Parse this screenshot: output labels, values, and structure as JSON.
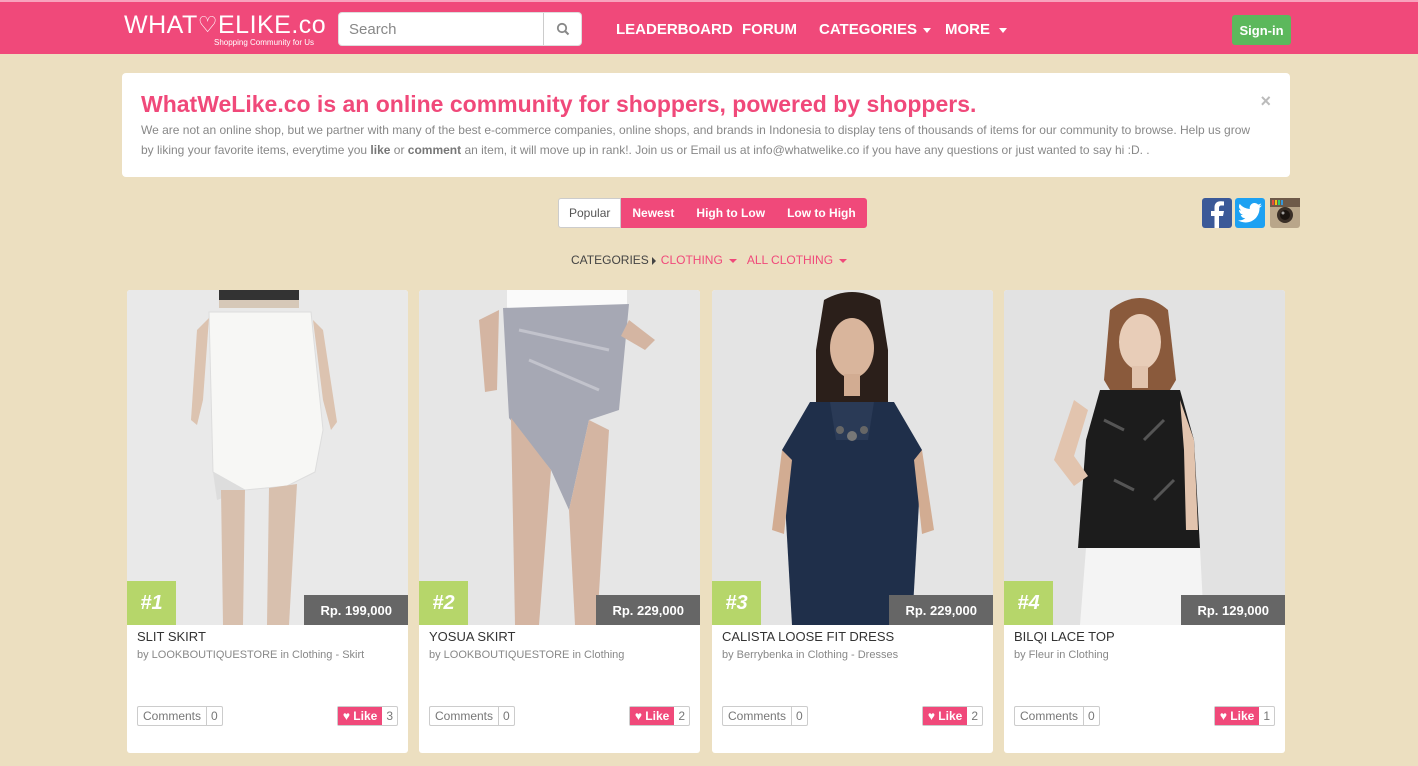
{
  "nav": {
    "logo_text": "WHATWELIKE.co",
    "logo_left": "WHAT",
    "logo_right": "ELIKE.co",
    "logo_tagline": "Shopping Community for Us",
    "search_placeholder": "Search",
    "links": [
      "LEADERBOARD",
      "FORUM",
      "CATEGORIES",
      "MORE"
    ],
    "signin_label": "Sign-in"
  },
  "banner": {
    "title": "WhatWeLike.co is an online community for shoppers, powered by shoppers.",
    "text_part1": "We are not an online shop, but we partner with many of the best e-commerce companies, online shops, and brands in Indonesia to display tens of thousands of items for our community to browse. Help us grow by liking your favorite items, everytime you ",
    "bold1": "like",
    "text_part2": " or ",
    "bold2": "comment",
    "text_part3": " an item, it will move up in rank!. Join us or Email us at info@whatwelike.co if you have any questions or just wanted to say hi :D. .",
    "close": "×"
  },
  "sort": [
    "Popular",
    "Newest",
    "High to Low",
    "Low to High"
  ],
  "breadcrumb": {
    "root": "CATEGORIES",
    "level1": "CLOTHING",
    "level2": "ALL CLOTHING"
  },
  "social": [
    "facebook-icon",
    "twitter-icon",
    "instagram-icon"
  ],
  "products": [
    {
      "rank": "#1",
      "price": "Rp. 199,000",
      "title": "SLIT SKIRT",
      "by": "by LOOKBOUTIQUESTORE in Clothing - Skirt",
      "comments_label": "Comments",
      "comments": "0",
      "like_label": "Like",
      "likes": "3"
    },
    {
      "rank": "#2",
      "price": "Rp. 229,000",
      "title": "YOSUA SKIRT",
      "by": "by LOOKBOUTIQUESTORE in Clothing",
      "comments_label": "Comments",
      "comments": "0",
      "like_label": "Like",
      "likes": "2"
    },
    {
      "rank": "#3",
      "price": "Rp. 229,000",
      "title": "CALISTA LOOSE FIT DRESS",
      "by": "by Berrybenka in Clothing - Dresses",
      "comments_label": "Comments",
      "comments": "0",
      "like_label": "Like",
      "likes": "2"
    },
    {
      "rank": "#4",
      "price": "Rp. 129,000",
      "title": "BILQI LACE TOP",
      "by": "by Fleur in Clothing",
      "comments_label": "Comments",
      "comments": "0",
      "like_label": "Like",
      "likes": "1"
    }
  ],
  "colors": {
    "brand": "#f0497a",
    "background": "#ecdfc0",
    "rank_badge": "#b6d66a",
    "signin": "#5cb85c"
  }
}
